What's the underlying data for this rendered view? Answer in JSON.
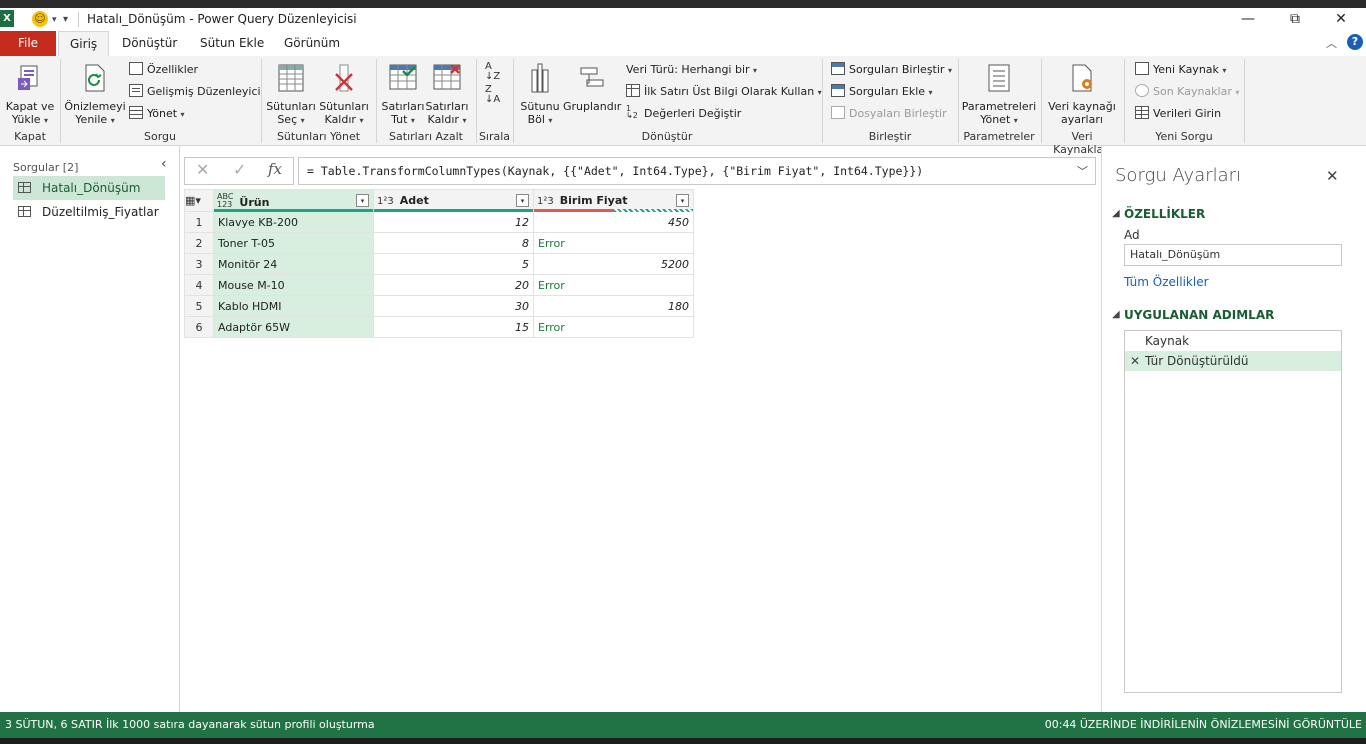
{
  "window": {
    "title": "Hatalı_Dönüşüm - Power Query Düzenleyicisi",
    "app_icon": "X",
    "minimize": "—",
    "restore": "⧉",
    "close": "✕"
  },
  "tabs": {
    "file": "File",
    "home": "Giriş",
    "transform": "Dönüştür",
    "add_column": "Sütun Ekle",
    "view": "Görünüm"
  },
  "ribbon": {
    "close_load": "Kapat ve\nYükle",
    "close_load_l1": "Kapat ve",
    "close_load_l2": "Yükle",
    "group_close": "Kapat",
    "refresh_l1": "Önizlemeyi",
    "refresh_l2": "Yenile",
    "properties": "Özellikler",
    "advanced_editor": "Gelişmiş Düzenleyici",
    "manage": "Yönet",
    "group_query": "Sorgu",
    "choose_cols_l1": "Sütunları",
    "choose_cols_l2": "Seç",
    "remove_cols_l1": "Sütunları",
    "remove_cols_l2": "Kaldır",
    "group_manage_cols": "Sütunları Yönet",
    "keep_rows_l1": "Satırları",
    "keep_rows_l2": "Tut",
    "remove_rows_l1": "Satırları",
    "remove_rows_l2": "Kaldır",
    "group_reduce_rows": "Satırları Azalt",
    "group_sort": "Sırala",
    "split_col_l1": "Sütunu",
    "split_col_l2": "Böl",
    "group_by": "Gruplandır",
    "data_type": "Veri Türü: Herhangi bir",
    "first_row_header": "İlk Satırı Üst Bilgi Olarak Kullan",
    "replace_values": "Değerleri Değiştir",
    "group_transform": "Dönüştür",
    "merge_queries": "Sorguları Birleştir",
    "append_queries": "Sorguları Ekle",
    "combine_files": "Dosyaları Birleştir",
    "group_combine": "Birleştir",
    "manage_params_l1": "Parametreleri",
    "manage_params_l2": "Yönet",
    "group_params": "Parametreler",
    "ds_settings_l1": "Veri kaynağı",
    "ds_settings_l2": "ayarları",
    "group_data_sources": "Veri Kaynakları",
    "new_source": "Yeni Kaynak",
    "recent_sources": "Son Kaynaklar",
    "enter_data": "Verileri Girin",
    "group_new_query": "Yeni Sorgu"
  },
  "queries_pane": {
    "header": "Sorgular [2]",
    "items": [
      "Hatalı_Dönüşüm",
      "Düzeltilmiş_Fiyatlar"
    ]
  },
  "formula": {
    "text": "= Table.TransformColumnTypes(Kaynak, {{\"Adet\", Int64.Type}, {\"Birim Fiyat\", Int64.Type}})"
  },
  "table": {
    "headers": [
      {
        "type": "ABC\n123",
        "name": "Ürün"
      },
      {
        "type": "1²3",
        "name": "Adet"
      },
      {
        "type": "1²3",
        "name": "Birim Fiyat"
      }
    ],
    "rows": [
      {
        "n": "1",
        "urun": "Klavye KB-200",
        "adet": "12",
        "fiyat": "450"
      },
      {
        "n": "2",
        "urun": "Toner T-05",
        "adet": "8",
        "fiyat": "Error"
      },
      {
        "n": "3",
        "urun": "Monitör 24",
        "adet": "5",
        "fiyat": "5200"
      },
      {
        "n": "4",
        "urun": "Mouse M-10",
        "adet": "20",
        "fiyat": "Error"
      },
      {
        "n": "5",
        "urun": "Kablo HDMI",
        "adet": "30",
        "fiyat": "180"
      },
      {
        "n": "6",
        "urun": "Adaptör 65W",
        "adet": "15",
        "fiyat": "Error"
      }
    ]
  },
  "settings_pane": {
    "title": "Sorgu Ayarları",
    "properties_header": "ÖZELLİKLER",
    "name_label": "Ad",
    "name_value": "Hatalı_Dönüşüm",
    "all_properties": "Tüm Özellikler",
    "steps_header": "UYGULANAN ADIMLAR",
    "steps": [
      "Kaynak",
      "Tür Dönüştürüldü"
    ]
  },
  "status": {
    "left": "3 SÜTUN, 6 SATIR",
    "profile": "İlk 1000 satıra dayanarak sütun profili oluşturma",
    "right": "00:44 ÜZERİNDE İNDİRİLENİN ÖNİZLEMESİNİ GÖRÜNTÜLE"
  },
  "colors": {
    "accent_green": "#217346",
    "file_red": "#c42b1c",
    "error_green": "#1a7a3a",
    "selected_col": "#d8efe0"
  }
}
